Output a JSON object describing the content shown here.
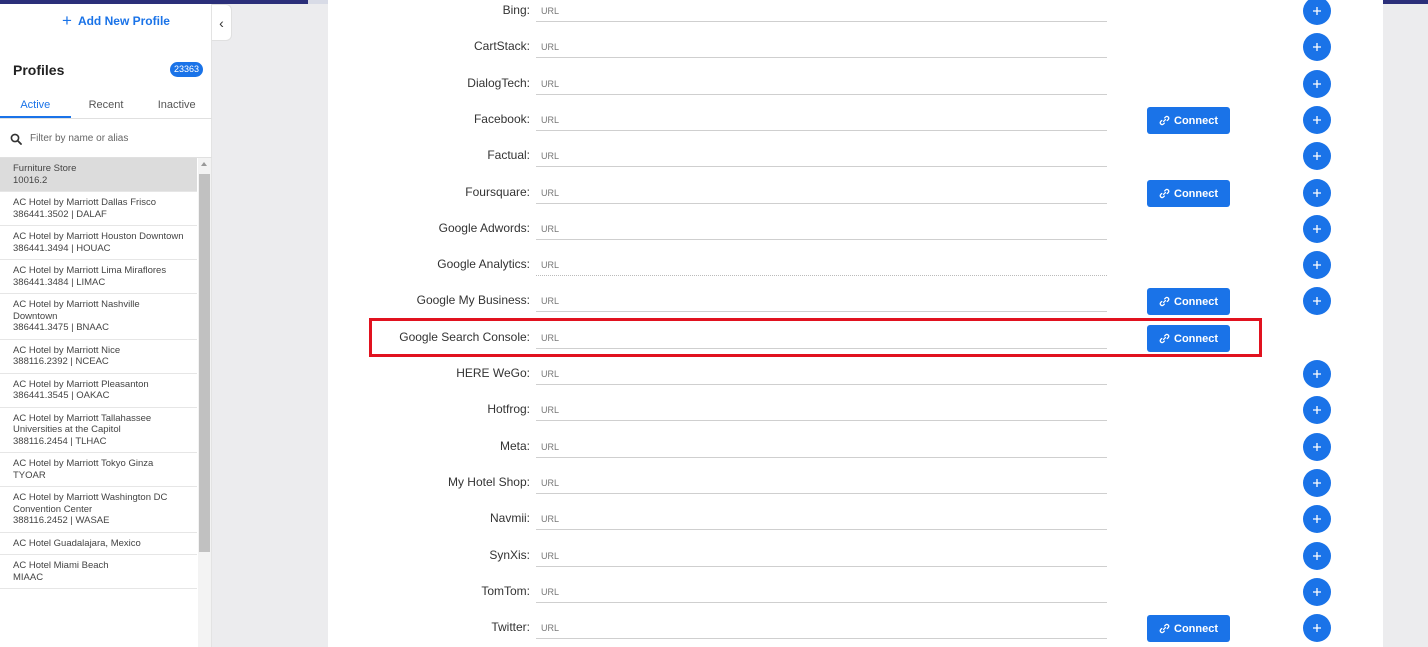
{
  "sidebar": {
    "add_profile": "Add New Profile",
    "collapse_icon": "chevron-left-icon",
    "title": "Profiles",
    "count": "23363",
    "tabs": [
      "Active",
      "Recent",
      "Inactive"
    ],
    "active_tab": "Active",
    "filter_placeholder": "Filter by name or alias",
    "profiles": [
      {
        "name": "Furniture Store",
        "id": "10016.2"
      },
      {
        "name": "AC Hotel by Marriott Dallas Frisco",
        "id": "386441.3502 | DALAF"
      },
      {
        "name": "AC Hotel by Marriott Houston Downtown",
        "id": "386441.3494 | HOUAC"
      },
      {
        "name": "AC Hotel by Marriott Lima Miraflores",
        "id": "386441.3484 | LIMAC"
      },
      {
        "name": "AC Hotel by Marriott Nashville Downtown",
        "id": "386441.3475 | BNAAC"
      },
      {
        "name": "AC Hotel by Marriott Nice",
        "id": "388116.2392 | NCEAC"
      },
      {
        "name": "AC Hotel by Marriott Pleasanton",
        "id": "386441.3545 | OAKAC"
      },
      {
        "name": "AC Hotel by Marriott Tallahassee Universities at the Capitol",
        "id": "388116.2454 | TLHAC"
      },
      {
        "name": "AC Hotel by Marriott Tokyo Ginza",
        "id": "TYOAR"
      },
      {
        "name": "AC Hotel by Marriott Washington DC Convention Center",
        "id": "388116.2452 | WASAE"
      },
      {
        "name": "AC Hotel Guadalajara, Mexico",
        "id": ""
      },
      {
        "name": "AC Hotel Miami Beach",
        "id": "MIAAC"
      }
    ]
  },
  "main": {
    "url_placeholder": "URL",
    "connect_label": "Connect",
    "connect_icon": "link-icon",
    "add_icon": "plus-icon",
    "highlight_color": "#e1121f",
    "accent_color": "#1a73e8",
    "integrations": [
      {
        "name": "Bing:",
        "connect": false,
        "add": true
      },
      {
        "name": "CartStack:",
        "connect": false,
        "add": true
      },
      {
        "name": "DialogTech:",
        "connect": false,
        "add": true
      },
      {
        "name": "Facebook:",
        "connect": true,
        "add": true
      },
      {
        "name": "Factual:",
        "connect": false,
        "add": true
      },
      {
        "name": "Foursquare:",
        "connect": true,
        "add": true
      },
      {
        "name": "Google Adwords:",
        "connect": false,
        "add": true
      },
      {
        "name": "Google Analytics:",
        "connect": false,
        "add": true
      },
      {
        "name": "Google My Business:",
        "connect": true,
        "add": true
      },
      {
        "name": "Google Search Console:",
        "connect": true,
        "add": false,
        "highlighted": true
      },
      {
        "name": "HERE WeGo:",
        "connect": false,
        "add": true
      },
      {
        "name": "Hotfrog:",
        "connect": false,
        "add": true
      },
      {
        "name": "Meta:",
        "connect": false,
        "add": true
      },
      {
        "name": "My Hotel Shop:",
        "connect": false,
        "add": true
      },
      {
        "name": "Navmii:",
        "connect": false,
        "add": true
      },
      {
        "name": "SynXis:",
        "connect": false,
        "add": true
      },
      {
        "name": "TomTom:",
        "connect": false,
        "add": true
      },
      {
        "name": "Twitter:",
        "connect": true,
        "add": true
      }
    ]
  }
}
